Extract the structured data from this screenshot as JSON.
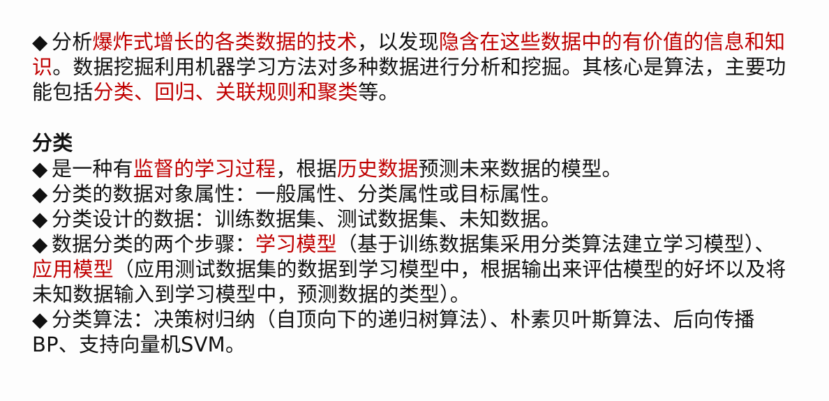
{
  "colors": {
    "text": "#111111",
    "highlight": "#c00000",
    "background": "#ffffff"
  },
  "bullet_symbol": "◆",
  "intro": {
    "segments": [
      {
        "text": "分析",
        "red": false
      },
      {
        "text": "爆炸式增长的各类数据的技术",
        "red": true
      },
      {
        "text": "，以发现",
        "red": false
      },
      {
        "text": "隐含在这些数据中的有价值的信息和知识",
        "red": true
      },
      {
        "text": "。数据挖掘利用机器学习方法对多种数据进行分析和挖掘。其核心是算法，主要功能包括",
        "red": false
      },
      {
        "text": "分类、回归、关联规则和聚类",
        "red": true
      },
      {
        "text": "等。",
        "red": false
      }
    ]
  },
  "section": {
    "heading": "分类",
    "items": [
      {
        "segments": [
          {
            "text": "是一种有",
            "red": false
          },
          {
            "text": "监督的学习过程",
            "red": true
          },
          {
            "text": "，根据",
            "red": false
          },
          {
            "text": "历史数据",
            "red": true
          },
          {
            "text": "预测未来数据的模型。",
            "red": false
          }
        ]
      },
      {
        "segments": [
          {
            "text": "分类的数据对象属性：一般属性、分类属性或目标属性。",
            "red": false
          }
        ]
      },
      {
        "segments": [
          {
            "text": "分类设计的数据：训练数据集、测试数据集、未知数据。",
            "red": false
          }
        ]
      },
      {
        "segments": [
          {
            "text": "数据分类的两个步骤：",
            "red": false
          },
          {
            "text": "学习模型",
            "red": true
          },
          {
            "text": "（基于训练数据集采用分类算法建立学习模型）、",
            "red": false
          },
          {
            "text": "应用模型",
            "red": true
          },
          {
            "text": "（应用测试数据集的数据到学习模型中，根据输出来评估模型的好坏以及将未知数据输入到学习模型中，预测数据的类型）。",
            "red": false
          }
        ]
      },
      {
        "segments": [
          {
            "text": "分类算法：决策树归纳（自顶向下的递归树算法）、朴素贝叶斯算法、后向传播BP、支持向量机SVM。",
            "red": false
          }
        ]
      }
    ]
  }
}
